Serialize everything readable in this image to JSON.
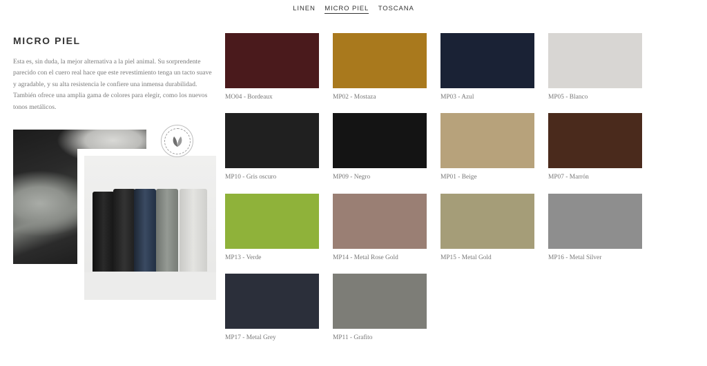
{
  "tabs": [
    {
      "label": "LINEN",
      "active": false
    },
    {
      "label": "MICRO PIEL",
      "active": true
    },
    {
      "label": "TOSCANA",
      "active": false
    }
  ],
  "section": {
    "title": "MICRO PIEL",
    "description": "Esta es, sin duda, la mejor alternativa a la piel animal. Su sorprendente parecido con el cuero real hace que este revestimiento tenga un tacto suave y agradable, y su alta resistencia le confiere una inmensa durabilidad. También ofrece una amplia gama de colores para elegir, como los nuevos tonos metálicos."
  },
  "swatches": [
    {
      "label": "MO04 - Bordeaux",
      "color": "#4a1a1c"
    },
    {
      "label": "MP02 - Mostaza",
      "color": "#a9791d"
    },
    {
      "label": "MP03 - Azul",
      "color": "#1a2235"
    },
    {
      "label": "MP05 - Blanco",
      "color": "#d8d6d3"
    },
    {
      "label": "MP10 - Gris oscuro",
      "color": "#202020"
    },
    {
      "label": "MP09 - Negro",
      "color": "#141414"
    },
    {
      "label": "MP01 - Beige",
      "color": "#b7a27b"
    },
    {
      "label": "MP07 - Marrón",
      "color": "#4a2a1c"
    },
    {
      "label": "MP13 - Verde",
      "color": "#8fb23a"
    },
    {
      "label": "MP14 - Metal Rose Gold",
      "color": "#9a7f74"
    },
    {
      "label": "MP15 - Metal Gold",
      "color": "#a59d78"
    },
    {
      "label": "MP16 - Metal Silver",
      "color": "#8e8e8e"
    },
    {
      "label": "MP17 - Metal Grey",
      "color": "#2b2f3a"
    },
    {
      "label": "MP11 - Grafito",
      "color": "#7d7d77"
    }
  ]
}
